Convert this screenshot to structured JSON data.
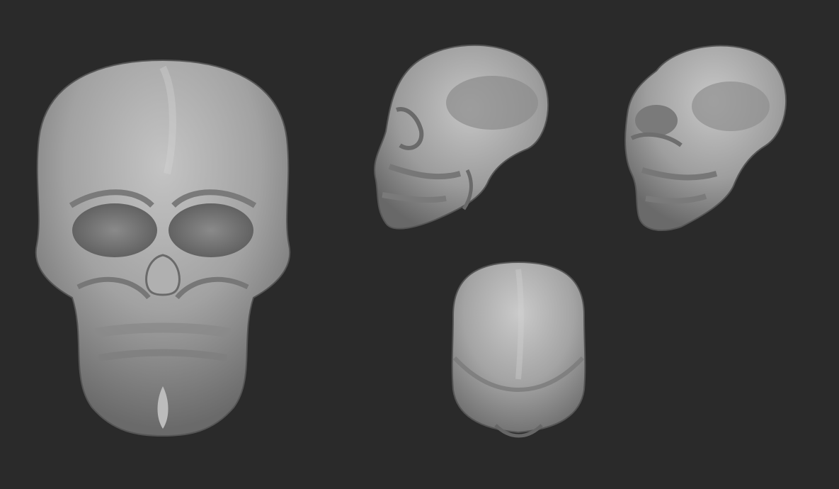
{
  "scene": {
    "background_color": "#2a2a2a",
    "material_color": "#9a9a9a",
    "views": [
      {
        "name": "front-view",
        "icon": "skull-front"
      },
      {
        "name": "side-view",
        "icon": "skull-side"
      },
      {
        "name": "three-quarter-view",
        "icon": "skull-three-quarter"
      },
      {
        "name": "back-view",
        "icon": "skull-back"
      }
    ]
  }
}
